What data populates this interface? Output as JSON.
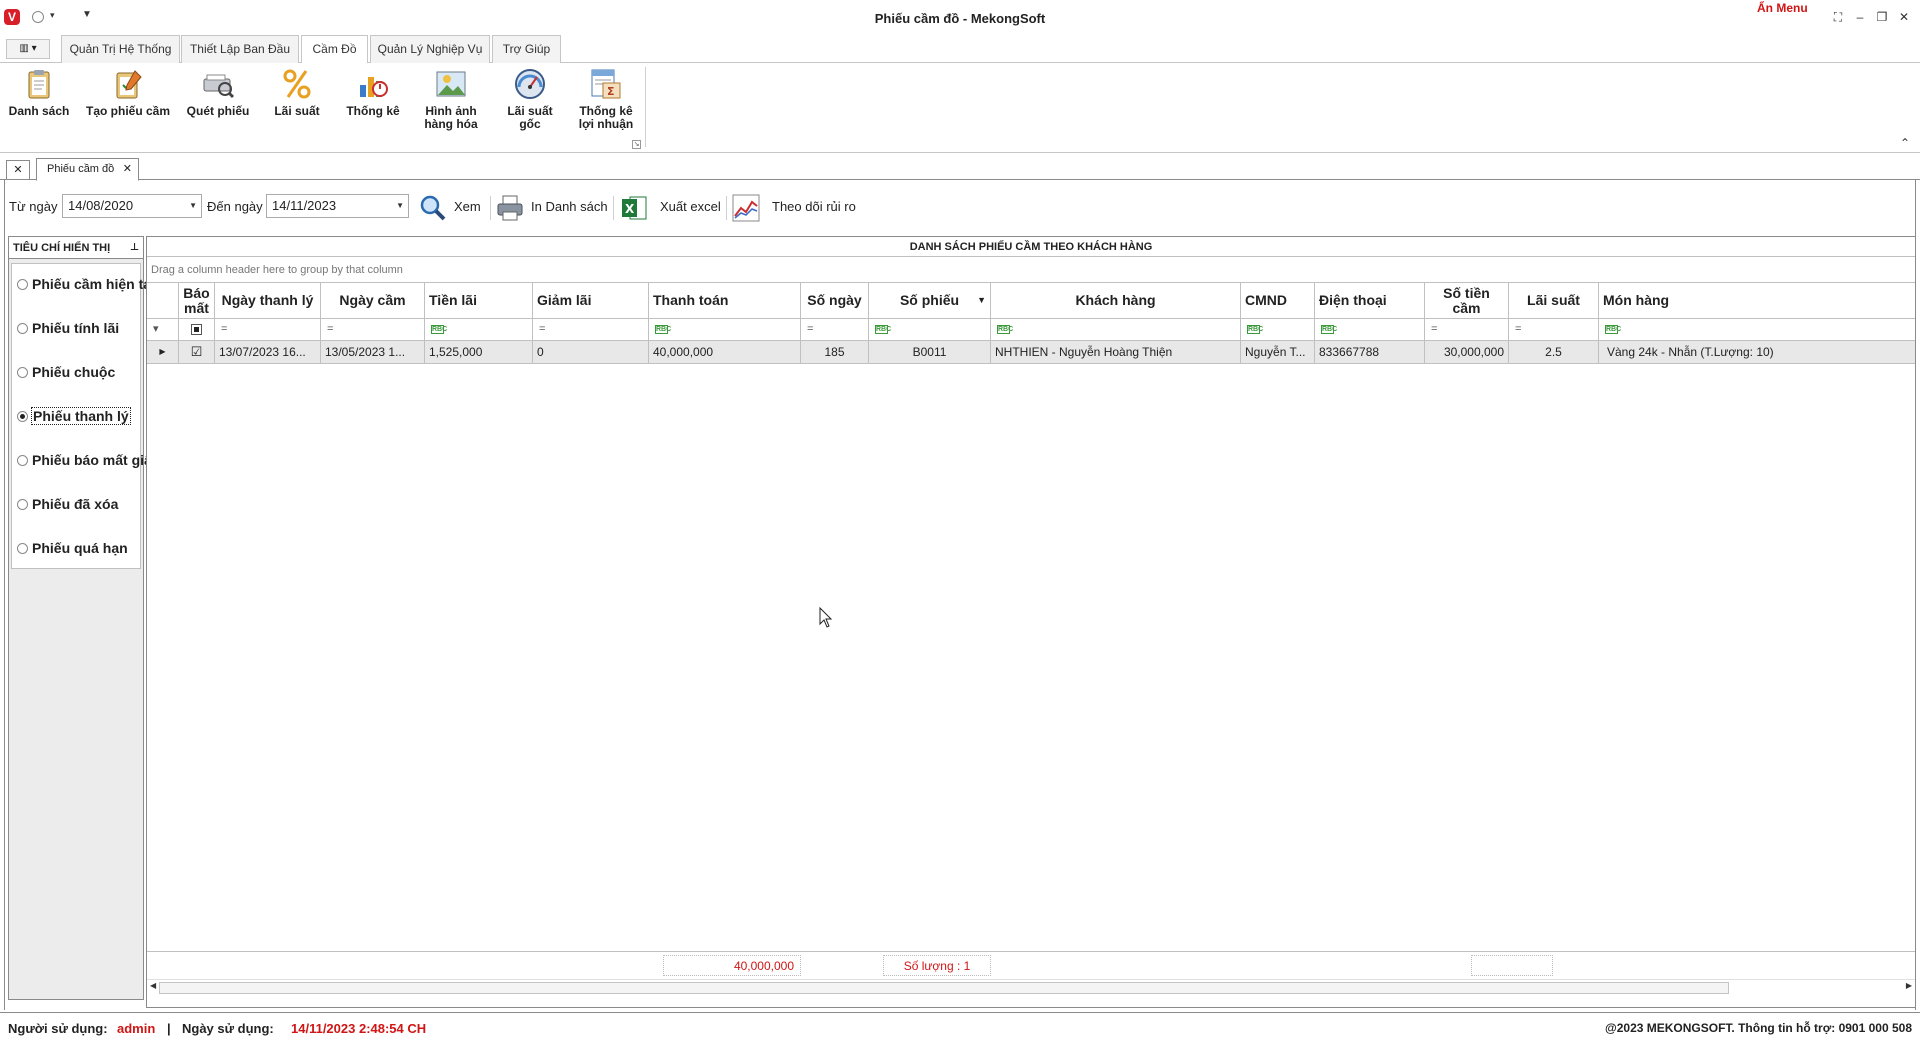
{
  "window": {
    "title": "Phiếu cầm đồ - MekongSoft",
    "hide_menu": "Ẩn Menu"
  },
  "ribbon_tabs": [
    {
      "label": "Quản Trị Hệ Thống"
    },
    {
      "label": "Thiết Lập Ban Đầu"
    },
    {
      "label": "Cầm Đồ",
      "active": true
    },
    {
      "label": "Quản Lý Nghiệp Vụ"
    },
    {
      "label": "Trợ Giúp"
    }
  ],
  "ribbon_buttons": [
    {
      "line1": "Danh sách",
      "line2": "",
      "icon": "clipboard-icon"
    },
    {
      "line1": "Tạo phiếu cầm",
      "line2": "",
      "icon": "pen-clipboard-icon"
    },
    {
      "line1": "Quét phiếu",
      "line2": "",
      "icon": "scan-icon"
    },
    {
      "line1": "Lãi suất",
      "line2": "",
      "icon": "percent-icon"
    },
    {
      "line1": "Thống kê",
      "line2": "",
      "icon": "chart-icon"
    },
    {
      "line1": "Hình ảnh",
      "line2": "hàng hóa",
      "icon": "image-icon"
    },
    {
      "line1": "Lãi suất",
      "line2": "gốc",
      "icon": "gauge-icon"
    },
    {
      "line1": "Thống kê",
      "line2": "lợi nhuận",
      "icon": "report-icon"
    }
  ],
  "doc_tab": {
    "label": "Phiếu cầm đồ"
  },
  "filter": {
    "from_label": "Từ ngày",
    "from_value": "14/08/2020",
    "to_label": "Đến ngày",
    "to_value": "14/11/2023",
    "view_label": "Xem",
    "print_label": "In Danh sách",
    "excel_label": "Xuất excel",
    "risk_label": "Theo dõi rủi ro"
  },
  "criteria": {
    "title": "TIÊU CHÍ HIỂN THỊ",
    "options": [
      {
        "label": "Phiếu cầm hiện tại",
        "selected": false
      },
      {
        "label": "Phiếu tính lãi",
        "selected": false
      },
      {
        "label": "Phiếu chuộc",
        "selected": false
      },
      {
        "label": "Phiếu thanh lý",
        "selected": true
      },
      {
        "label": "Phiếu báo mất giấy",
        "selected": false
      },
      {
        "label": "Phiếu đã xóa",
        "selected": false
      },
      {
        "label": "Phiếu quá hạn",
        "selected": false
      }
    ]
  },
  "grid": {
    "caption": "DANH SÁCH PHIẾU CẦM THEO KHÁCH HÀNG",
    "group_hint": "Drag a column header here to group by that column",
    "columns": {
      "bao_mat_1": "Báo",
      "bao_mat_2": "mất",
      "ngay_thanh_ly": "Ngày thanh lý",
      "ngay_cam": "Ngày cầm",
      "tien_lai": "Tiền lãi",
      "giam_lai": "Giảm lãi",
      "thanh_toan": "Thanh toán",
      "so_ngay": "Số ngày",
      "so_phieu": "Số phiếu",
      "khach_hang": "Khách hàng",
      "cmnd": "CMND",
      "dien_thoai": "Điện thoại",
      "so_tien_cam_1": "Số tiền",
      "so_tien_cam_2": "cầm",
      "lai_suat": "Lãi suất",
      "mon_hang": "Món hàng"
    },
    "rows": [
      {
        "ngay_thanh_ly": "13/07/2023 16...",
        "ngay_cam": "13/05/2023 1...",
        "tien_lai": "1,525,000",
        "giam_lai": "0",
        "thanh_toan": "40,000,000",
        "so_ngay": "185",
        "so_phieu": "B0011",
        "khach_hang": "NHTHIEN - Nguyễn Hoàng Thiện",
        "cmnd": "Nguyễn T...",
        "dien_thoai": "833667788",
        "so_tien_cam": "30,000,000",
        "lai_suat": "2.5",
        "mon_hang": "Vàng 24k - Nhẫn (T.Lượng: 10)"
      }
    ],
    "footer": {
      "thanh_toan_total": "40,000,000",
      "count": "Số lượng : 1"
    }
  },
  "status": {
    "user_label": "Người sử dụng:",
    "user_value": "admin",
    "sep": "|",
    "date_label": "Ngày sử dụng:",
    "date_value": "14/11/2023 2:48:54 CH",
    "copyright": "@2023 MEKONGSOFT. Thông tin hỗ trợ: 0901 000 508"
  },
  "colors": {
    "accent_red": "#d01515",
    "excel_green": "#1f7a3a"
  }
}
